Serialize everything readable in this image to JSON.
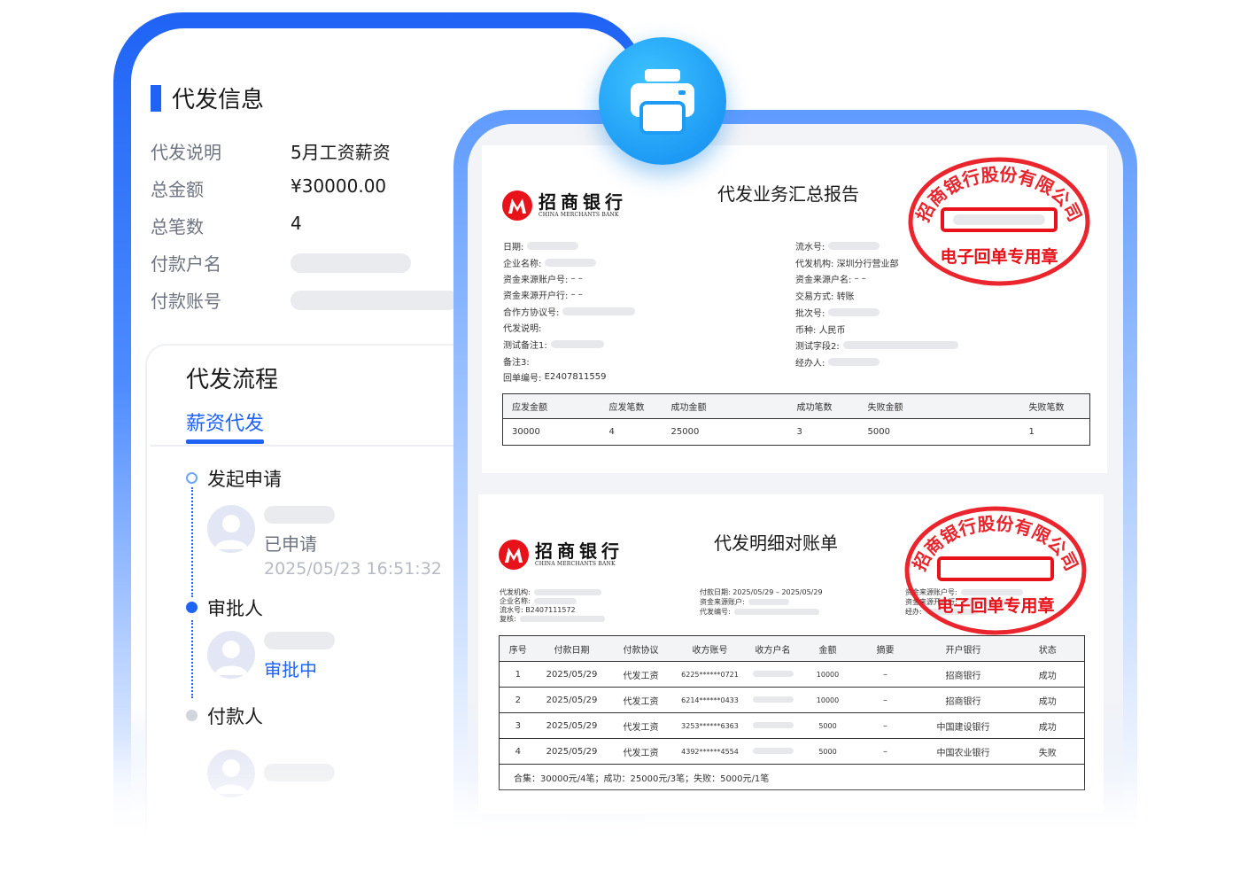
{
  "info": {
    "title": "代发信息",
    "rows": [
      {
        "label": "代发说明",
        "value": "5月工资薪资"
      },
      {
        "label": "总金额",
        "value": "¥30000.00"
      },
      {
        "label": "总笔数",
        "value": "4"
      },
      {
        "label": "付款户名",
        "value": ""
      },
      {
        "label": "付款账号",
        "value": ""
      }
    ]
  },
  "flow": {
    "title": "代发流程",
    "tab": "薪资代发",
    "steps": [
      {
        "label": "发起申请",
        "status": "已申请",
        "time": "2025/05/23 16:51:32"
      },
      {
        "label": "审批人",
        "status": "审批中"
      },
      {
        "label": "付款人"
      }
    ]
  },
  "colors": {
    "accent": "#1f63f5",
    "seal": "#e8121b"
  },
  "bank": {
    "name_cn": "招商银行",
    "name_en": "CHINA MERCHANTS BANK"
  },
  "seal_text": "招商银行股份有限公司",
  "seal_sub": "电子回单专用章",
  "summary_doc": {
    "title": "代发业务汇总报告",
    "left_fields": [
      {
        "label": "日期:",
        "value": ""
      },
      {
        "label": "企业名称:",
        "value": ""
      },
      {
        "label": "资金来源账户号:",
        "value": "– –"
      },
      {
        "label": "资金来源开户行:",
        "value": "– –"
      },
      {
        "label": "合作方协议号:",
        "value": ""
      },
      {
        "label": "代发说明:",
        "value": ""
      },
      {
        "label": "测试备注1:",
        "value": ""
      },
      {
        "label": "备注3:",
        "value": ""
      },
      {
        "label": "回单编号:",
        "value": "E2407811559"
      }
    ],
    "right_fields": [
      {
        "label": "流水号:",
        "value": ""
      },
      {
        "label": "代发机构:",
        "value": "深圳分行营业部"
      },
      {
        "label": "资金来源户名:",
        "value": "– –"
      },
      {
        "label": "交易方式:",
        "value": "转账"
      },
      {
        "label": "批次号:",
        "value": ""
      },
      {
        "label": "币种:",
        "value": "人民币"
      },
      {
        "label": "测试字段2:",
        "value": ""
      },
      {
        "label": "经办人:",
        "value": ""
      }
    ],
    "table": {
      "headers": [
        "应发金额",
        "应发笔数",
        "成功金额",
        "成功笔数",
        "失败金额",
        "失败笔数"
      ],
      "row": [
        "30000",
        "4",
        "25000",
        "3",
        "5000",
        "1"
      ]
    }
  },
  "detail_doc": {
    "title": "代发明细对账单",
    "left_fields": [
      {
        "label": "代发机构:",
        "value": ""
      },
      {
        "label": "企业名称:",
        "value": ""
      },
      {
        "label": "流水号:",
        "value": "B2407111572"
      },
      {
        "label": "复核:",
        "value": ""
      }
    ],
    "mid_fields": [
      {
        "label": "付款日期:",
        "value": "2025/05/29 – 2025/05/29"
      },
      {
        "label": "资金来源账户:",
        "value": ""
      },
      {
        "label": "代发编号:",
        "value": ""
      }
    ],
    "right_fields": [
      {
        "label": "资金来源账户号:",
        "value": ""
      },
      {
        "label": "资金来源开户行:",
        "value": ""
      },
      {
        "label": "经办:",
        "value": ""
      }
    ],
    "headers": [
      "序号",
      "付款日期",
      "付款协议",
      "收方账号",
      "收方户名",
      "金额",
      "摘要",
      "开户银行",
      "状态"
    ],
    "rows": [
      [
        "1",
        "2025/05/29",
        "代发工资",
        "6225******0721",
        "",
        "10000",
        "–",
        "招商银行",
        "成功"
      ],
      [
        "2",
        "2025/05/29",
        "代发工资",
        "6214******0433",
        "",
        "10000",
        "–",
        "招商银行",
        "成功"
      ],
      [
        "3",
        "2025/05/29",
        "代发工资",
        "3253******6363",
        "",
        "5000",
        "–",
        "中国建设银行",
        "成功"
      ],
      [
        "4",
        "2025/05/29",
        "代发工资",
        "4392******4554",
        "",
        "5000",
        "–",
        "中国农业银行",
        "失败"
      ]
    ],
    "total": "合集：30000元/4笔；成功：25000元/3笔；失败：5000元/1笔"
  }
}
